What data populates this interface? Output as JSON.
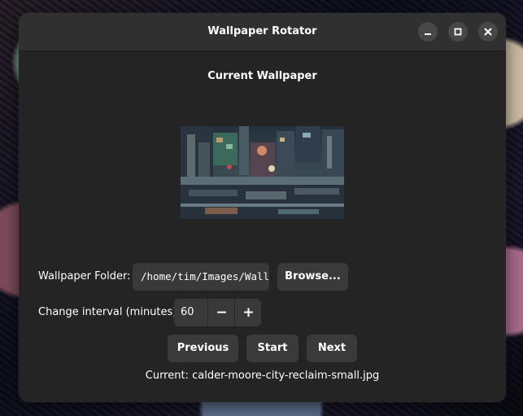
{
  "window": {
    "title": "Wallpaper Rotator",
    "controls": [
      "minimize-icon",
      "maximize-icon",
      "close-icon"
    ]
  },
  "main": {
    "section_title": "Current Wallpaper",
    "preview_alt": "calder-moore-city-reclaim-small.jpg"
  },
  "folder": {
    "label": "Wallpaper Folder:",
    "value": "/home/tim/Images/Wall",
    "browse_label": "Browse..."
  },
  "interval": {
    "label": "Change interval (minutes):",
    "value": "60",
    "decrement_label": "−",
    "increment_label": "+"
  },
  "actions": {
    "previous_label": "Previous",
    "start_label": "Start",
    "next_label": "Next"
  },
  "status": {
    "text": "Current: calder-moore-city-reclaim-small.jpg"
  },
  "colors": {
    "window_bg": "#242424",
    "headerbar_bg": "#303030",
    "button_bg": "#3a3a3a",
    "entry_bg": "#393939",
    "text": "#ffffff"
  }
}
